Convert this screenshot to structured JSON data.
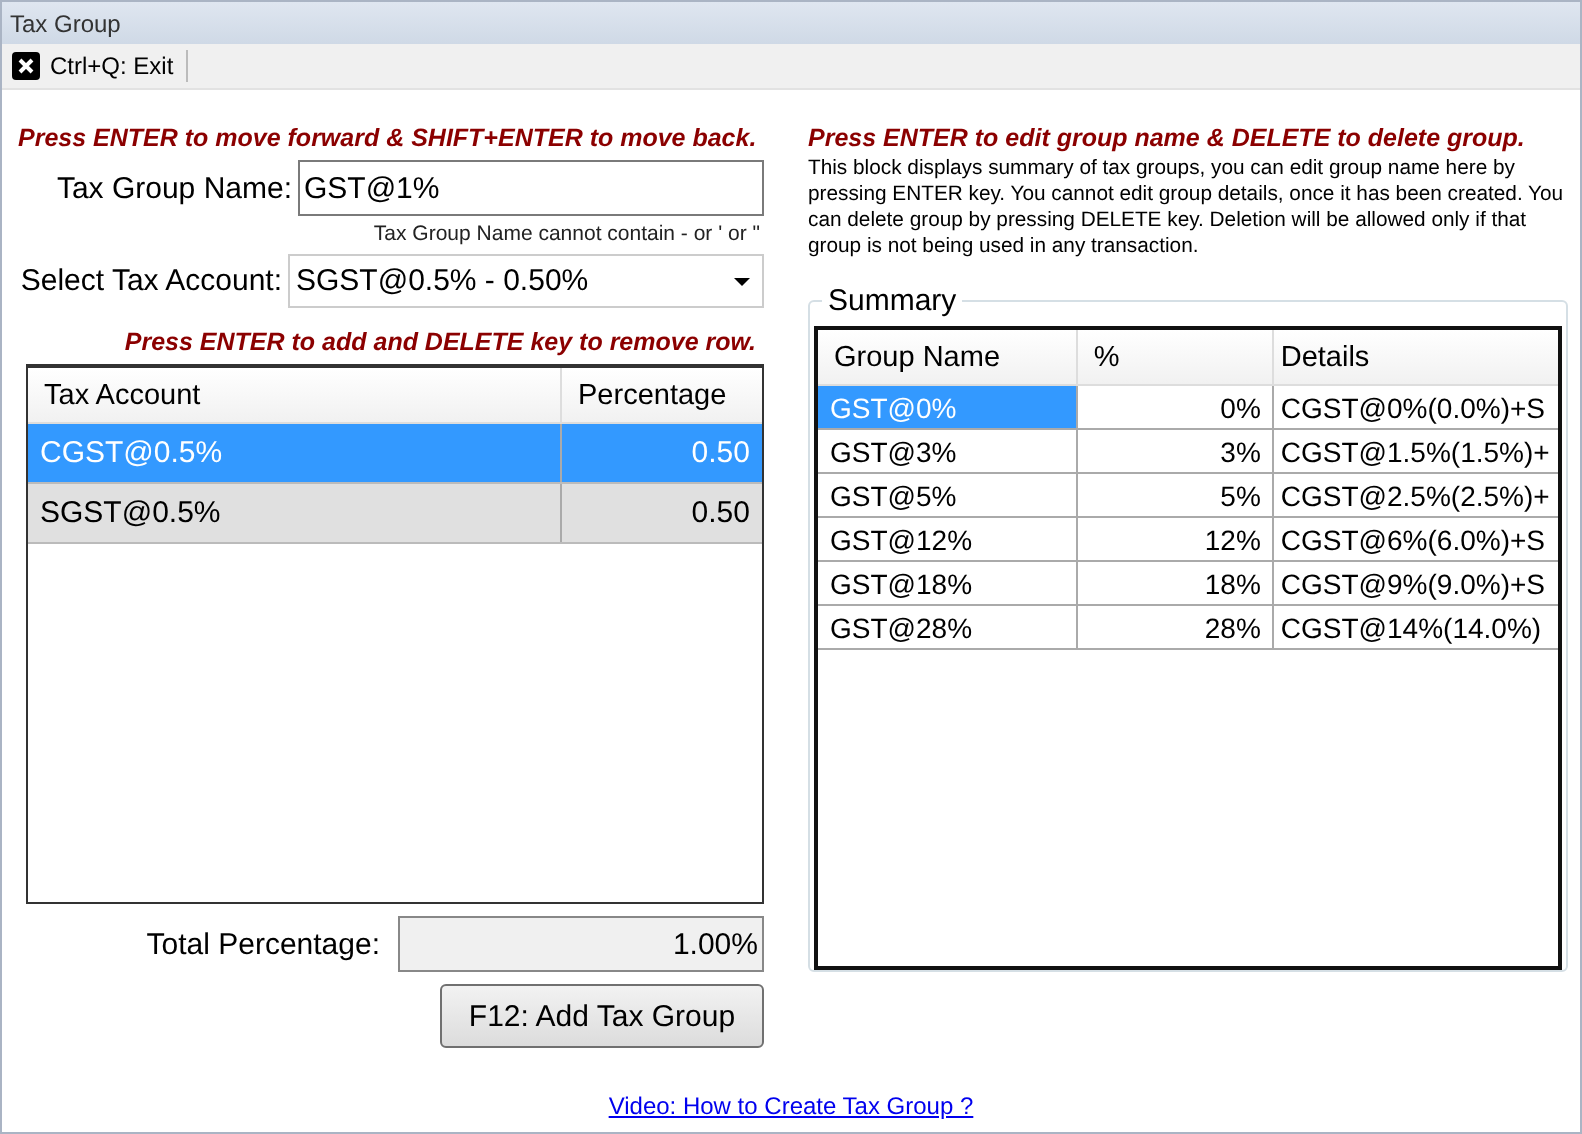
{
  "window": {
    "title": "Tax Group"
  },
  "toolbar": {
    "exit_label": "Ctrl+Q: Exit"
  },
  "form": {
    "hint": "Press ENTER to move forward & SHIFT+ENTER to move back.",
    "name_label": "Tax Group Name:",
    "name_value": "GST@1%",
    "name_note": "Tax Group Name cannot contain - or ' or \"",
    "account_label": "Select Tax Account:",
    "account_value": "SGST@0.5% - 0.50%",
    "grid_hint": "Press ENTER to add and DELETE key to remove row.",
    "columns": [
      "Tax Account",
      "Percentage"
    ],
    "rows": [
      {
        "account": "CGST@0.5%",
        "percentage": "0.50",
        "selected": true
      },
      {
        "account": "SGST@0.5%",
        "percentage": "0.50",
        "selected": false
      }
    ],
    "total_label": "Total Percentage:",
    "total_value": "1.00%",
    "add_button": "F12: Add Tax Group"
  },
  "summary_panel": {
    "hint": "Press ENTER to edit group name & DELETE to delete group.",
    "description": "This block displays summary of tax groups, you can edit group name here by pressing ENTER key. You cannot edit group details, once it has been created. You can delete group by pressing DELETE key. Deletion will be allowed only if that group is not being used in any transaction.",
    "title": "Summary",
    "columns": [
      "Group Name",
      "%",
      "Details"
    ],
    "rows": [
      {
        "name": "GST@0%",
        "percent": "0%",
        "details": "CGST@0%(0.0%)+S",
        "selected": true
      },
      {
        "name": "GST@3%",
        "percent": "3%",
        "details": "CGST@1.5%(1.5%)+",
        "selected": false
      },
      {
        "name": "GST@5%",
        "percent": "5%",
        "details": "CGST@2.5%(2.5%)+",
        "selected": false
      },
      {
        "name": "GST@12%",
        "percent": "12%",
        "details": "CGST@6%(6.0%)+S",
        "selected": false
      },
      {
        "name": "GST@18%",
        "percent": "18%",
        "details": "CGST@9%(9.0%)+S",
        "selected": false
      },
      {
        "name": "GST@28%",
        "percent": "28%",
        "details": "CGST@14%(14.0%)",
        "selected": false
      }
    ]
  },
  "video_link": "Video: How to Create Tax Group ?"
}
